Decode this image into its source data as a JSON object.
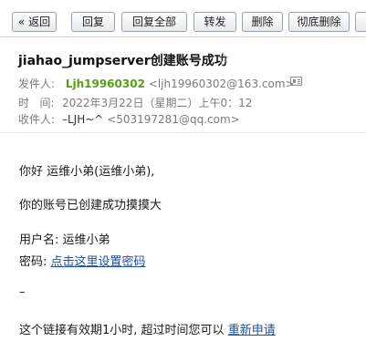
{
  "toolbar": {
    "back_label": "« 返回",
    "reply_label": "回复",
    "reply_all_label": "回复全部",
    "forward_label": "转发",
    "delete_label": "删除",
    "purge_label": "彻底删除",
    "more_label": ""
  },
  "email": {
    "subject": "jiahao_jumpserver创建账号成功",
    "star_icon": "star-outline-icon",
    "from": {
      "label": "发件人:",
      "name": "Ljh19960302",
      "address": "<ljh19960302@163.com>"
    },
    "time": {
      "label": "时   间:",
      "value": "2022年3月22日（星期二）上午0：12"
    },
    "to": {
      "label": "收件人:",
      "name": "–LJH~^",
      "address": "<503197281@qq.com>"
    }
  },
  "body": {
    "greeting": "你好 运维小弟(运维小弟),",
    "message": "你的账号已创建成功摸摸大",
    "username_label": "用户名:",
    "username_value": "运维小弟",
    "password_label": "密码:",
    "password_link": "点击这里设置密码",
    "dash": "–",
    "expire_text": "这个链接有效期1小时, 超过时间您可以",
    "reapply_link": "重新申请"
  }
}
